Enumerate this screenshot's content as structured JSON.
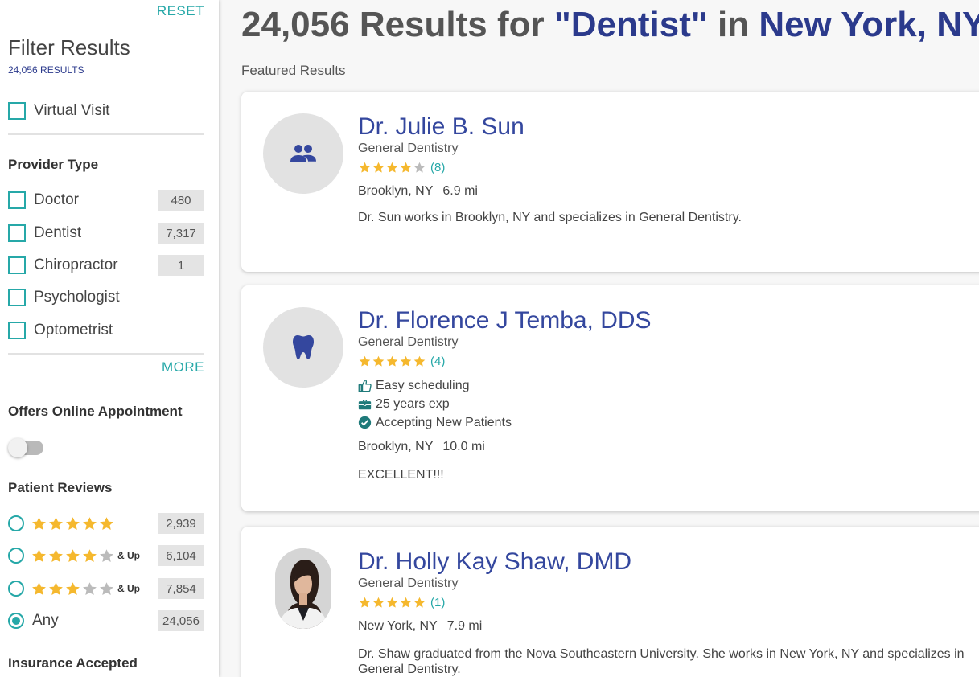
{
  "sidebar": {
    "reset_label": "RESET",
    "title": "Filter Results",
    "results_count": "24,056 RESULTS",
    "virtual_visit_label": "Virtual Visit",
    "provider_type": {
      "heading": "Provider Type",
      "items": [
        {
          "label": "Doctor",
          "count": "480"
        },
        {
          "label": "Dentist",
          "count": "7,317"
        },
        {
          "label": "Chiropractor",
          "count": "1"
        },
        {
          "label": "Psychologist"
        },
        {
          "label": "Optometrist"
        }
      ],
      "more_label": "MORE"
    },
    "online_appointment": {
      "heading": "Offers Online Appointment",
      "enabled": false
    },
    "patient_reviews": {
      "heading": "Patient Reviews",
      "options": [
        {
          "stars": 5,
          "suffix": "",
          "count": "2,939",
          "selected": false
        },
        {
          "stars": 4,
          "suffix": "& Up",
          "count": "6,104",
          "selected": false
        },
        {
          "stars": 3,
          "suffix": "& Up",
          "count": "7,854",
          "selected": false
        },
        {
          "label": "Any",
          "count": "24,056",
          "selected": true
        }
      ]
    },
    "insurance_heading": "Insurance Accepted"
  },
  "header": {
    "count": "24,056",
    "results_for": "Results for",
    "query": "\"Dentist\"",
    "in_word": "in",
    "location": "New York, NY"
  },
  "featured_label": "Featured Results",
  "colors": {
    "accent": "#26a8a8",
    "brand": "#2b3a8c",
    "name": "#34479e",
    "star": "#f5b82e",
    "star_empty": "#bbbbbb"
  },
  "cards": [
    {
      "name": "Dr. Julie B. Sun",
      "specialty": "General Dentistry",
      "rating": 4,
      "review_count": "(8)",
      "avatar_icon": "group-icon",
      "city": "Brooklyn, NY",
      "distance": "6.9 mi",
      "description": "Dr. Sun works in Brooklyn, NY and specializes in General Dentistry."
    },
    {
      "name": "Dr. Florence J Temba, DDS",
      "specialty": "General Dentistry",
      "rating": 5,
      "review_count": "(4)",
      "avatar_icon": "tooth-icon",
      "features": [
        {
          "icon": "thumbs-up-icon",
          "label": "Easy scheduling"
        },
        {
          "icon": "briefcase-icon",
          "label": "25 years exp"
        },
        {
          "icon": "check-circle-icon",
          "label": "Accepting New Patients"
        }
      ],
      "city": "Brooklyn, NY",
      "distance": "10.0 mi",
      "description": "EXCELLENT!!!"
    },
    {
      "name": "Dr. Holly Kay Shaw, DMD",
      "specialty": "General Dentistry",
      "rating": 5,
      "review_count": "(1)",
      "avatar_icon": "profile-photo",
      "city": "New York, NY",
      "distance": "7.9 mi",
      "description": "Dr. Shaw graduated from the Nova Southeastern University. She works in New York, NY and specializes in General Dentistry."
    }
  ]
}
